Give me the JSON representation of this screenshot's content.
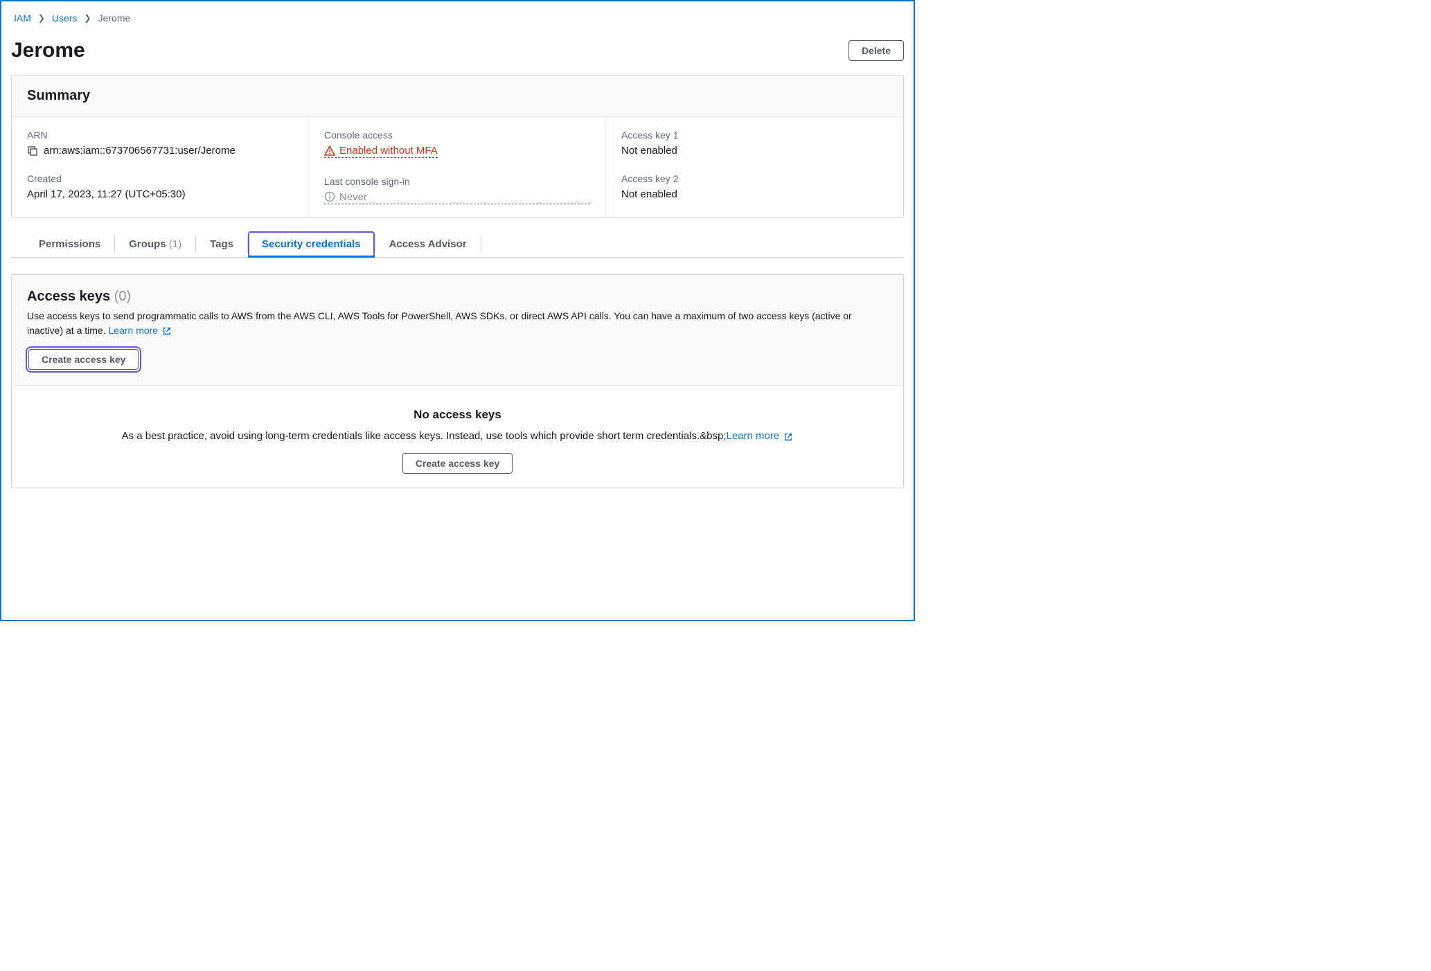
{
  "breadcrumb": {
    "iam": "IAM",
    "users": "Users",
    "current": "Jerome"
  },
  "title": "Jerome",
  "delete_btn": "Delete",
  "summary": {
    "heading": "Summary",
    "arn_label": "ARN",
    "arn_value": "arn:aws:iam::673706567731:user/Jerome",
    "created_label": "Created",
    "created_value": "April 17, 2023, 11:27 (UTC+05:30)",
    "console_access_label": "Console access",
    "console_access_value": "Enabled without MFA",
    "last_signin_label": "Last console sign-in",
    "last_signin_value": "Never",
    "ak1_label": "Access key 1",
    "ak1_value": "Not enabled",
    "ak2_label": "Access key 2",
    "ak2_value": "Not enabled"
  },
  "tabs": {
    "permissions": "Permissions",
    "groups": "Groups",
    "groups_count": "(1)",
    "tags": "Tags",
    "security": "Security credentials",
    "advisor": "Access Advisor"
  },
  "access_keys": {
    "title": "Access keys",
    "count": "(0)",
    "desc": "Use access keys to send programmatic calls to AWS from the AWS CLI, AWS Tools for PowerShell, AWS SDKs, or direct AWS API calls. You can have a maximum of two access keys (active or inactive) at a time. ",
    "learn_more": "Learn more",
    "create_btn": "Create access key",
    "empty_title": "No access keys",
    "empty_desc": "As a best practice, avoid using long-term credentials like access keys. Instead, use tools which provide short term credentials.&bsp;",
    "empty_learn": "Learn more",
    "empty_create": "Create access key"
  }
}
